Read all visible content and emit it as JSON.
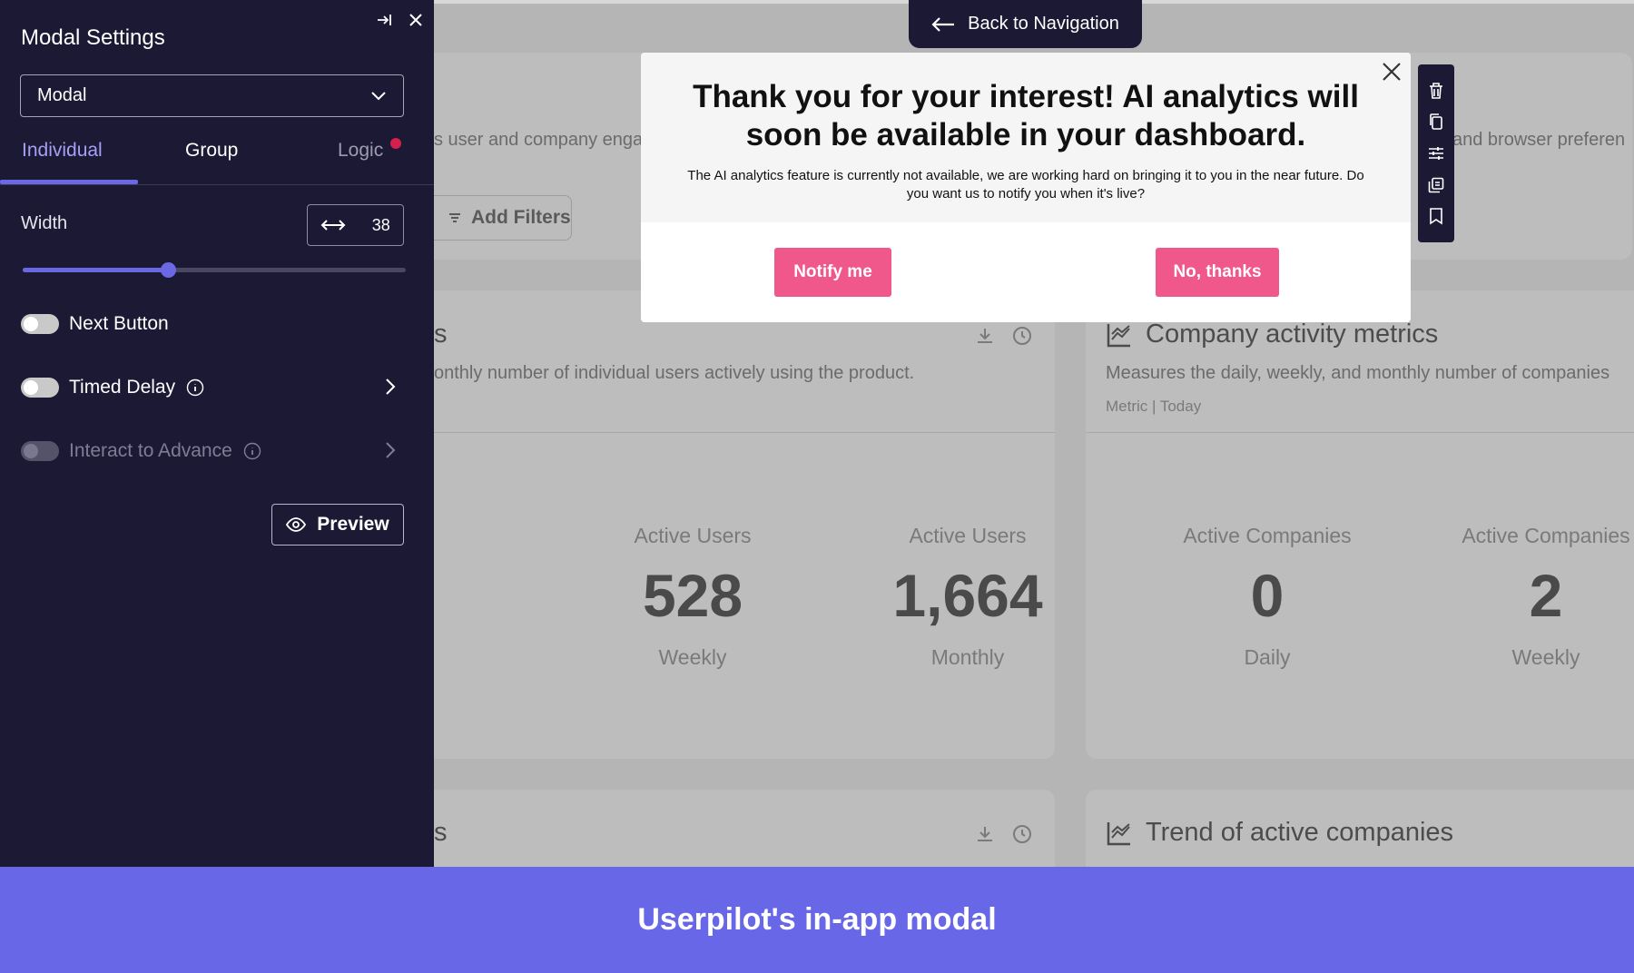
{
  "panel": {
    "title": "Modal Settings",
    "select_value": "Modal",
    "tabs": [
      {
        "label": "Individual",
        "active": true
      },
      {
        "label": "Group",
        "active": false
      },
      {
        "label": "Logic",
        "active": false,
        "badge_color": "#d3204d"
      }
    ],
    "width_label": "Width",
    "width_value": "38",
    "width_slider_fraction": 0.38,
    "options": [
      {
        "label": "Next Button",
        "on": false,
        "disabled": false
      },
      {
        "label": "Timed Delay",
        "on": false,
        "disabled": false,
        "info_icon": "info-icon",
        "chevron": true
      },
      {
        "label": "Interact to Advance",
        "on": false,
        "disabled": true,
        "info_icon": "info-icon",
        "chevron": true
      }
    ],
    "preview_label": "Preview"
  },
  "back_nav": {
    "label": "Back to Navigation"
  },
  "modal": {
    "title": "Thank you for your interest! AI analytics will soon be available in your dashboard.",
    "body": "The AI analytics feature is currently not available, we are working hard on bringing it to you in the near future. Do you want us to notify you when it's live?",
    "primary_label": "Notify me",
    "secondary_label": "No, thanks",
    "button_color": "#f0578a"
  },
  "toolbar_icons": [
    "trash-icon",
    "copy-icon",
    "sliders-icon",
    "duplicate-icon",
    "bookmark-icon"
  ],
  "dashboard": {
    "fragment_left_top": "s user and company enga",
    "fragment_right_top": "and browser preferen",
    "filter_label": "Add Filters",
    "card1": {
      "title_fragment": "s",
      "desc_fragment": "onthly number of individual users actively using the product.",
      "stats": [
        {
          "label": "Active Users",
          "value": "528",
          "period": "Weekly"
        },
        {
          "label": "Active Users",
          "value": "1,664",
          "period": "Monthly"
        }
      ]
    },
    "card2": {
      "title": "Company activity metrics",
      "desc": "Measures the daily, weekly, and monthly number of companies",
      "meta": "Metric | Today",
      "stats": [
        {
          "label": "Active Companies",
          "value": "0",
          "period": "Daily"
        },
        {
          "label": "Active Companies",
          "value": "2",
          "period": "Weekly"
        }
      ]
    },
    "card3": {
      "title_fragment": "s"
    },
    "card4": {
      "title": "Trend of active companies"
    }
  },
  "banner": {
    "caption": "Userpilot's in-app modal",
    "color": "#6767e8"
  },
  "colors": {
    "panel_bg": "#1c1935",
    "accent": "#6b68e6",
    "tab_active": "#a6a0f5"
  }
}
